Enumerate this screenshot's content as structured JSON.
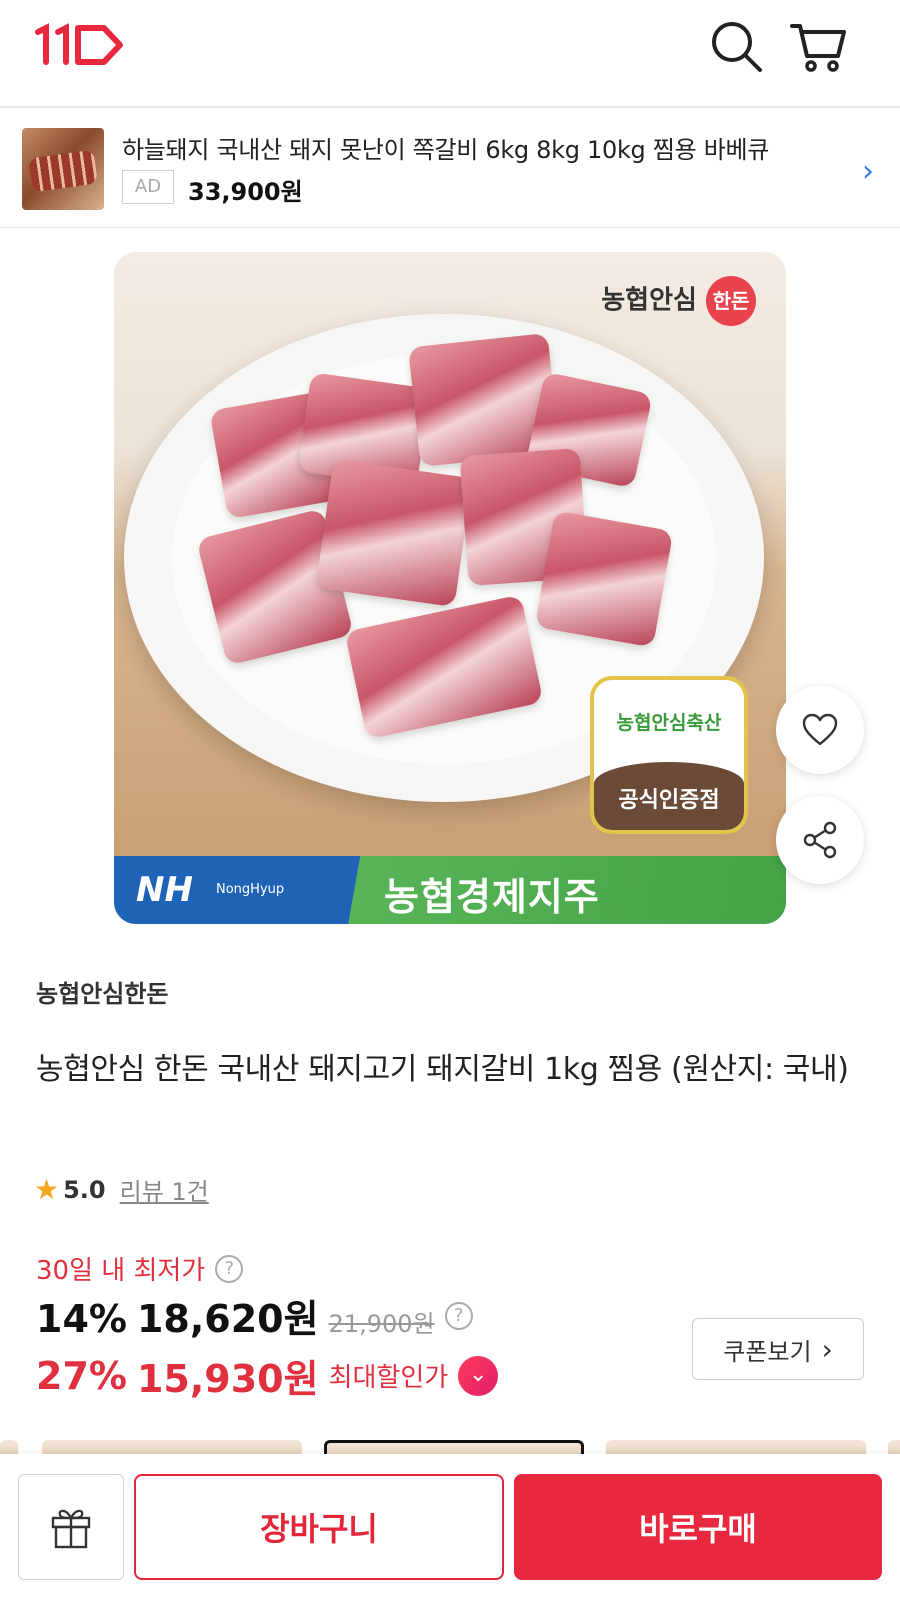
{
  "header": {
    "logo_icon": "11st-logo",
    "search_icon": "search-icon",
    "cart_icon": "cart-icon",
    "logo_color": "#e8283f"
  },
  "ad_banner": {
    "title": "하늘돼지 국내산 돼지 못난이 쪽갈비 6kg 8kg 10kg 찜용 바베큐",
    "badge": "AD",
    "price": "33,900원"
  },
  "product_image": {
    "brand_logo_text": "농협안심",
    "brand_logo_circle": "한돈",
    "cert_top": "농협안심축산",
    "cert_bottom": "공식인증점",
    "nh_logo": "NH",
    "nh_sub": "NongHyup",
    "nh_right": "농협경제지주"
  },
  "product": {
    "seller": "농협안심한돈",
    "title": "농협안심 한돈 국내산 돼지고기 돼지갈비 1kg 찜용 (원산지: 국내)",
    "rating_score": "5.0",
    "review_link": "리뷰 1건",
    "lowest_label": "30일 내 최저가",
    "discount1": "14%",
    "price1": "18,620원",
    "original_price": "21,900원",
    "discount2": "27%",
    "price2": "15,930원",
    "max_discount_label": "최대할인가",
    "coupon_button": "쿠폰보기"
  },
  "bottom_bar": {
    "gift_icon": "gift-icon",
    "cart_button": "장바구니",
    "buy_button": "바로구매",
    "accent": "#e8283f"
  }
}
